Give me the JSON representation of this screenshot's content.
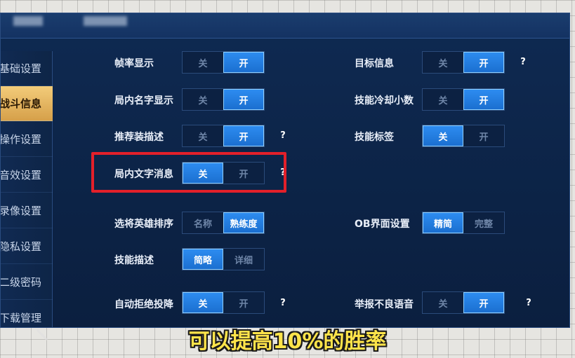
{
  "sidebar": {
    "items": [
      {
        "label": "基础设置",
        "active": false
      },
      {
        "label": "战斗信息",
        "active": true
      },
      {
        "label": "操作设置",
        "active": false
      },
      {
        "label": "音效设置",
        "active": false
      },
      {
        "label": "录像设置",
        "active": false
      },
      {
        "label": "隐私设置",
        "active": false
      },
      {
        "label": "二级密码",
        "active": false
      },
      {
        "label": "下载管理",
        "active": false
      }
    ]
  },
  "settings": {
    "frame_rate": {
      "label": "帧率显示",
      "off": "关",
      "on": "开",
      "selected": "开"
    },
    "name_display": {
      "label": "局内名字显示",
      "off": "关",
      "on": "开",
      "selected": "开"
    },
    "item_desc": {
      "label": "推荐装描述",
      "off": "关",
      "on": "开",
      "selected": "开",
      "help": "?"
    },
    "text_message": {
      "label": "局内文字消息",
      "off": "关",
      "on": "开",
      "selected": "关",
      "help": "?"
    },
    "hero_sort": {
      "label": "选将英雄排序",
      "opt1": "名称",
      "opt2": "熟练度",
      "selected": "熟练度"
    },
    "skill_desc": {
      "label": "技能描述",
      "opt1": "简略",
      "opt2": "详细",
      "selected": "简略"
    },
    "auto_reject": {
      "label": "自动拒绝投降",
      "off": "关",
      "on": "开",
      "selected": "关",
      "help": "?"
    },
    "target_info": {
      "label": "目标信息",
      "off": "关",
      "on": "开",
      "selected": "开",
      "help": "?"
    },
    "cooldown_decimal": {
      "label": "技能冷却小数",
      "off": "关",
      "on": "开",
      "selected": "开"
    },
    "skill_tag": {
      "label": "技能标签",
      "off": "关",
      "on": "开",
      "selected": "关"
    },
    "ob_ui": {
      "label": "OB界面设置",
      "opt1": "精简",
      "opt2": "完整",
      "selected": "精简"
    },
    "report_voice": {
      "label": "举报不良语音",
      "off": "关",
      "on": "开",
      "selected": "开",
      "help": "?"
    }
  },
  "caption": "可以提高10%的胜率",
  "colors": {
    "accent": "#2d8cf0",
    "highlight_box": "#e3202a",
    "active_tab": "#e0b05a",
    "caption": "#ffe44a"
  }
}
